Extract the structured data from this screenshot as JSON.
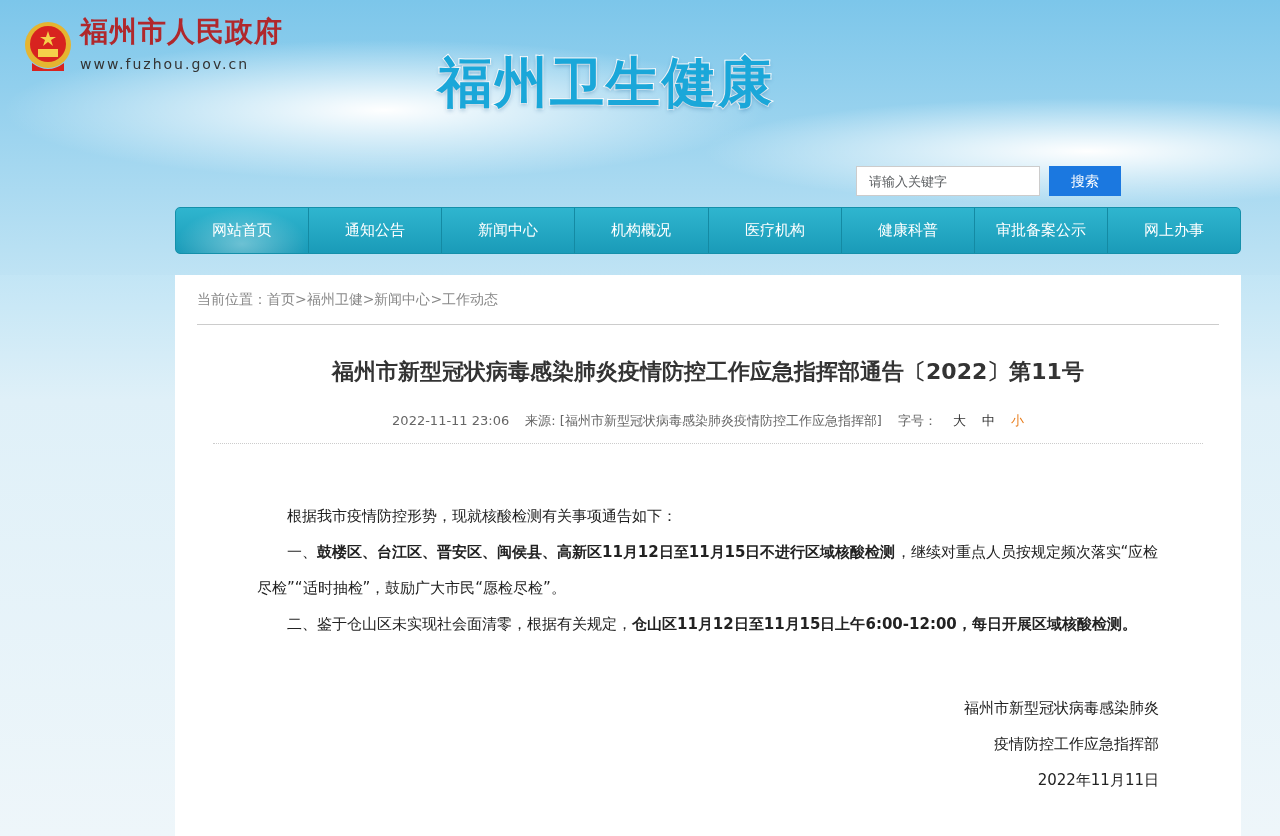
{
  "header": {
    "site_name": "福州市人民政府",
    "site_url": "www.fuzhou.gov.cn",
    "banner_title": "福州卫生健康",
    "search": {
      "placeholder": "请输入关键字",
      "button": "搜索"
    }
  },
  "nav": [
    {
      "label": "网站首页",
      "selected": true
    },
    {
      "label": "通知公告",
      "selected": false
    },
    {
      "label": "新闻中心",
      "selected": false
    },
    {
      "label": "机构概况",
      "selected": false
    },
    {
      "label": "医疗机构",
      "selected": false
    },
    {
      "label": "健康科普",
      "selected": false
    },
    {
      "label": "审批备案公示",
      "selected": false
    },
    {
      "label": "网上办事",
      "selected": false
    }
  ],
  "breadcrumb": {
    "label": "当前位置：",
    "items": [
      "首页",
      "福州卫健",
      "新闻中心",
      "工作动态"
    ],
    "separator": ">"
  },
  "article": {
    "title": "福州市新型冠状病毒感染肺炎疫情防控工作应急指挥部通告〔2022〕第11号",
    "meta": {
      "date": "2022-11-11 23:06",
      "source": "来源: [福州市新型冠状病毒感染肺炎疫情防控工作应急指挥部]",
      "size_label": "字号：",
      "sizes": [
        {
          "label": "大",
          "selected": false
        },
        {
          "label": "中",
          "selected": false
        },
        {
          "label": "小",
          "selected": true
        }
      ]
    },
    "paragraphs": [
      "根据我市疫情防控形势，现就核酸检测有关事项通告如下：",
      "一、**鼓楼区、台江区、晋安区、闽侯县、高新区11月12日至11月15日不进行区域核酸检测**，继续对重点人员按规定频次落实“应检尽检”“适时抽检”，鼓励广大市民“愿检尽检”。",
      "二、鉴于仓山区未实现社会面清零，根据有关规定，**仓山区11月12日至11月15日上午6:00-12:00，每日开展区域核酸检测。**"
    ],
    "signature": [
      "福州市新型冠状病毒感染肺炎",
      "疫情防控工作应急指挥部",
      "2022年11月11日"
    ]
  }
}
